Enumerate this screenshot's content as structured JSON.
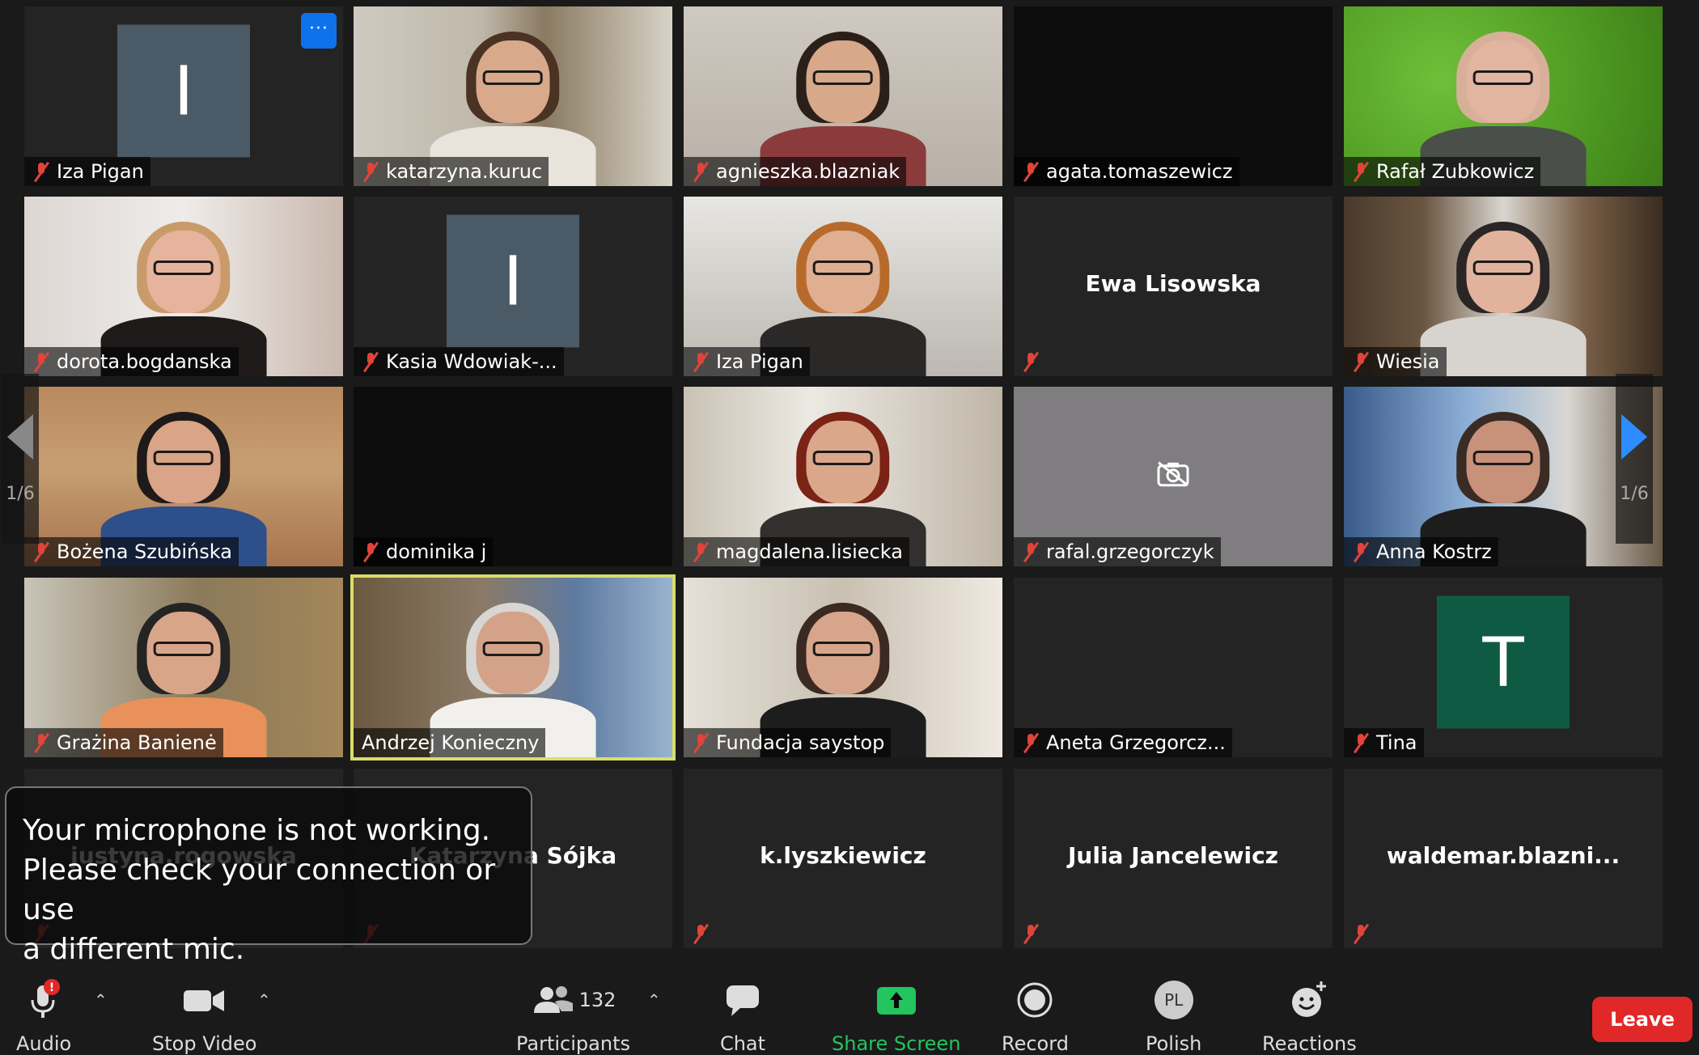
{
  "meeting": {
    "page_indicator_left": "1/6",
    "page_indicator_right": "1/6"
  },
  "tiles": [
    {
      "name": "Iza Pigan",
      "initial": "I",
      "type": "avatar",
      "avatar_color": "#4a5a66",
      "muted": true,
      "more_button": "···"
    },
    {
      "name": "katarzyna.kuruc",
      "type": "video",
      "muted": true
    },
    {
      "name": "agnieszka.blazniak",
      "type": "video",
      "muted": true
    },
    {
      "name": "agata.tomaszewicz",
      "type": "video-dark",
      "muted": true
    },
    {
      "name": "Rafał Zubkowicz",
      "type": "video",
      "muted": true
    },
    {
      "name": "dorota.bogdanska",
      "type": "video",
      "muted": true
    },
    {
      "name": "Kasia Wdowiak-...",
      "initial": "I",
      "type": "avatar",
      "avatar_color": "#4a5a66",
      "muted": true
    },
    {
      "name": "Iza Pigan",
      "type": "video",
      "muted": true
    },
    {
      "name": "Ewa Lisowska",
      "type": "name-only",
      "muted": true
    },
    {
      "name": "Wiesia",
      "type": "video",
      "muted": true
    },
    {
      "name": "Bożena Szubińska",
      "type": "video",
      "muted": true
    },
    {
      "name": "dominika j",
      "type": "video-dark",
      "muted": true
    },
    {
      "name": "magdalena.lisiecka",
      "type": "video",
      "muted": true
    },
    {
      "name": "rafal.grzegorczyk",
      "type": "camera-off",
      "muted": true
    },
    {
      "name": "Anna Kostrz",
      "type": "video",
      "muted": true
    },
    {
      "name": "Grażina Banienė",
      "type": "video",
      "muted": true
    },
    {
      "name": "Andrzej Konieczny",
      "type": "video",
      "muted": false,
      "speaking": true
    },
    {
      "name": "Fundacja saystop",
      "type": "video",
      "muted": true
    },
    {
      "name": "Aneta Grzegorcz...",
      "type": "blank",
      "muted": true
    },
    {
      "name": "Tina",
      "initial": "T",
      "type": "avatar",
      "avatar_color": "#0f5a43",
      "muted": true
    },
    {
      "name": "justyna.rogowska",
      "type": "name-only",
      "muted": true
    },
    {
      "name": "Katarzyna Sójka",
      "type": "name-only",
      "muted": true
    },
    {
      "name": "k.lyszkiewicz",
      "type": "name-only",
      "muted": true
    },
    {
      "name": "Julia Jancelewicz",
      "type": "name-only",
      "muted": true
    },
    {
      "name": "waldemar.blazni...",
      "type": "name-only",
      "muted": true
    }
  ],
  "toast": {
    "line1": "Your microphone is not working.",
    "line2": "Please check your connection or use",
    "line3": "a different mic."
  },
  "toolbar": {
    "audio": "Audio",
    "audio_badge": "!",
    "stop_video": "Stop Video",
    "participants": "Participants",
    "participants_count": "132",
    "chat": "Chat",
    "share_screen": "Share Screen",
    "record": "Record",
    "language": "Polish",
    "language_badge": "PL",
    "reactions": "Reactions",
    "leave": "Leave"
  },
  "colors": {
    "background": "#1a1a1a",
    "tile": "#242424",
    "accent_blue": "#2d8cff",
    "share_green": "#22c55e",
    "leave_red": "#e02828",
    "muted_red": "#e0443a",
    "speaking_outline": "#d9dd6a"
  }
}
